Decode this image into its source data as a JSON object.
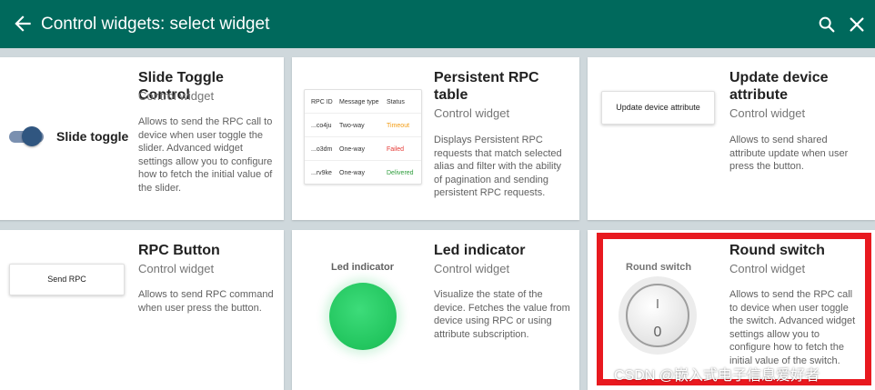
{
  "header": {
    "title": "Control widgets: select widget",
    "background_color": "#00695c",
    "icons": [
      "arrow-left-icon",
      "search-icon",
      "close-icon"
    ]
  },
  "widgets": [
    {
      "title": "Slide Toggle Control",
      "subtitle": "Control widget",
      "description": "Allows to send the RPC call to device when user toggle the slider. Advanced widget settings allow you to configure how to fetch the initial value of the slider.",
      "preview": {
        "label": "Slide toggle",
        "toggle_on": true,
        "track_color": "#7a90b0",
        "thumb_color": "#305680"
      }
    },
    {
      "title": "Persistent RPC table",
      "subtitle": "Control widget",
      "description": "Displays Persistent RPC requests that match selected alias and filter with the ability of pagination and sending persistent RPC requests.",
      "preview": {
        "columns": [
          "RPC ID",
          "Message type",
          "Status"
        ],
        "rows": [
          {
            "id": "...co4ju",
            "type": "Two-way",
            "status": "Timeout",
            "status_color": "#f39c12"
          },
          {
            "id": "...o3dm",
            "type": "One-way",
            "status": "Failed",
            "status_color": "#e53935"
          },
          {
            "id": "...rv9ke",
            "type": "One-way",
            "status": "Delivered",
            "status_color": "#2e9d3c"
          }
        ]
      }
    },
    {
      "title": "Update device attribute",
      "subtitle": "Control widget",
      "description": "Allows to send shared attribute update when user press the button.",
      "preview": {
        "button_label": "Update device attribute"
      }
    },
    {
      "title": "RPC Button",
      "subtitle": "Control widget",
      "description": "Allows to send RPC command when user press the button.",
      "preview": {
        "button_label": "Send RPC"
      }
    },
    {
      "title": "Led indicator",
      "subtitle": "Control widget",
      "description": "Visualize the state of the device. Fetches the value from device using RPC or using attribute subscription.",
      "preview": {
        "label": "Led indicator",
        "led_color": "#22c55e"
      }
    },
    {
      "title": "Round switch",
      "subtitle": "Control widget",
      "description": "Allows to send the RPC call to device when user toggle the switch. Advanced widget settings allow you to configure how to fetch the initial value of the switch.",
      "preview": {
        "label": "Round switch",
        "on_symbol": "I",
        "off_symbol": "0"
      }
    }
  ],
  "highlight_color": "#e8191f",
  "watermark": "CSDN @嵌入式电子信息爱好者"
}
